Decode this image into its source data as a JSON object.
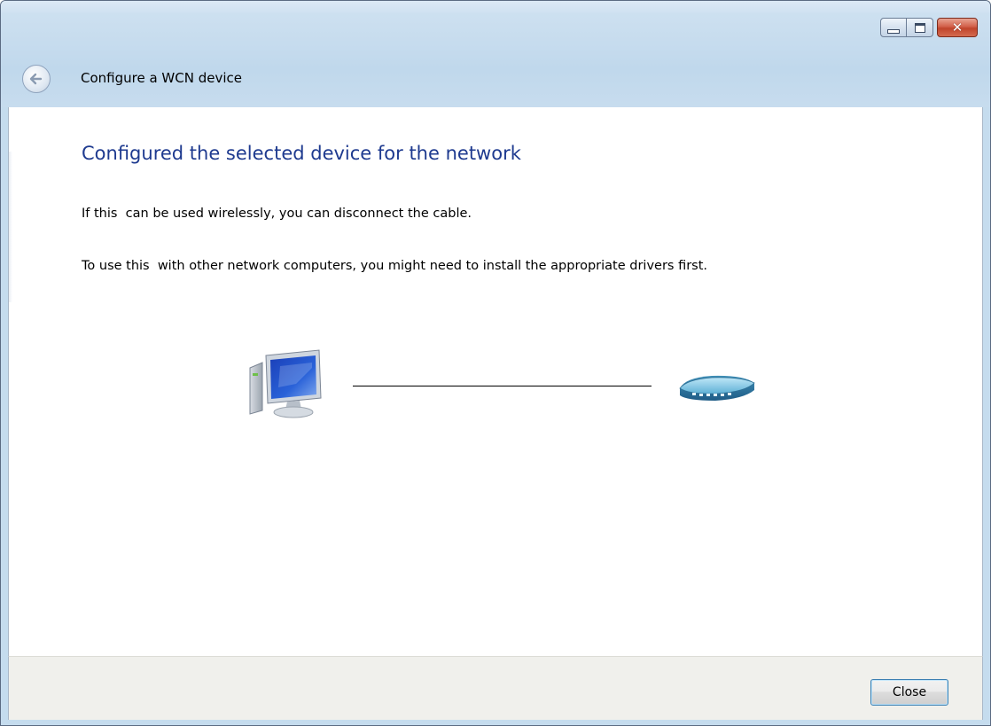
{
  "window": {
    "title": "Configure a WCN device",
    "caption": {
      "minimize_icon": "minimize-icon",
      "maximize_icon": "maximize-icon",
      "close_glyph": "✕"
    },
    "back_icon": "back-arrow-icon"
  },
  "main": {
    "heading": "Configured the selected device for the network",
    "paragraph_1": "If this  can be used wirelessly, you can disconnect the cable.",
    "paragraph_2": "To use this  with other network computers, you might need to install the appropriate drivers first.",
    "diagram": {
      "left_icon": "computer-icon",
      "right_icon": "router-icon"
    }
  },
  "footer": {
    "close_label": "Close"
  },
  "colors": {
    "heading": "#1e3a8f",
    "frame": "#c5dcee",
    "footer_bg": "#f0f0ec",
    "close_caption": "#c0442b"
  }
}
